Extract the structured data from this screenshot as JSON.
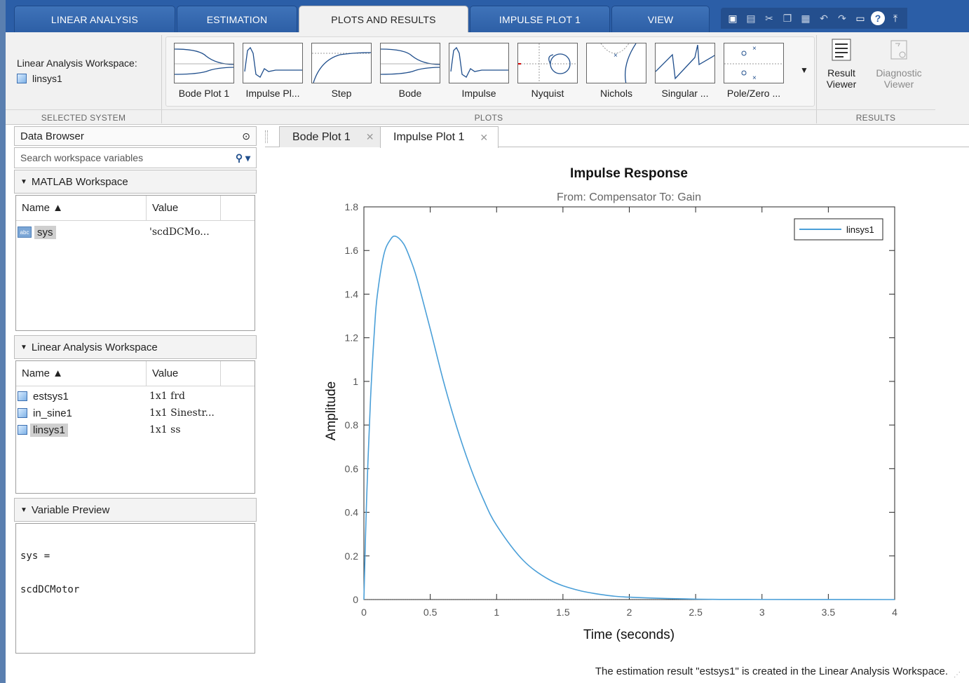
{
  "top_tabs": [
    {
      "label": "LINEAR ANALYSIS",
      "active": false
    },
    {
      "label": "ESTIMATION",
      "active": false
    },
    {
      "label": "PLOTS AND RESULTS",
      "active": true
    },
    {
      "label": "IMPULSE PLOT 1",
      "active": false
    },
    {
      "label": "VIEW",
      "active": false
    }
  ],
  "quick_access_icons": [
    "new-plot-icon",
    "save-icon",
    "cut-icon",
    "copy-icon",
    "paste-icon",
    "undo-icon",
    "redo-icon",
    "window-icon",
    "help-icon",
    "minimize-ribbon-icon"
  ],
  "ribbon": {
    "selected_system": {
      "title": "Linear Analysis Workspace:",
      "system": "linsys1",
      "footer": "SELECTED SYSTEM"
    },
    "plots": {
      "items": [
        "Bode Plot 1",
        "Impulse Pl...",
        "Step",
        "Bode",
        "Impulse",
        "Nyquist",
        "Nichols",
        "Singular ...",
        "Pole/Zero ..."
      ],
      "footer": "PLOTS",
      "more_glyph": "▼"
    },
    "results": {
      "result_viewer": [
        "Result",
        "Viewer"
      ],
      "diagnostic_viewer": [
        "Diagnostic",
        "Viewer"
      ],
      "footer": "RESULTS"
    }
  },
  "data_browser": {
    "title": "Data Browser",
    "search_placeholder": "Search workspace variables",
    "matlab_workspace": {
      "title": "MATLAB Workspace",
      "col_name": "Name ▲",
      "col_value": "Value",
      "rows": [
        {
          "name": "sys",
          "value": "'scdDCMo..."
        }
      ]
    },
    "linear_workspace": {
      "title": "Linear Analysis Workspace",
      "col_name": "Name ▲",
      "col_value": "Value",
      "rows": [
        {
          "name": "estsys1",
          "value": "1x1 frd"
        },
        {
          "name": "in_sine1",
          "value": "1x1 Sinestr..."
        },
        {
          "name": "linsys1",
          "value": "1x1 ss"
        }
      ]
    },
    "variable_preview": {
      "title": "Variable Preview",
      "lines": [
        "sys =",
        "scdDCMotor"
      ]
    }
  },
  "doc_tabs": [
    {
      "label": "Bode Plot 1",
      "active": false
    },
    {
      "label": "Impulse Plot 1",
      "active": true
    }
  ],
  "chart_data": {
    "type": "line",
    "title": "Impulse Response",
    "subtitle": "From: Compensator  To: Gain",
    "xlabel": "Time (seconds)",
    "ylabel": "Amplitude",
    "xlim": [
      0,
      4
    ],
    "ylim": [
      0,
      1.8
    ],
    "x_ticks": [
      "0",
      "0.5",
      "1",
      "1.5",
      "2",
      "2.5",
      "3",
      "3.5",
      "4"
    ],
    "y_ticks": [
      "0",
      "0.2",
      "0.4",
      "0.6",
      "0.8",
      "1",
      "1.2",
      "1.4",
      "1.6",
      "1.8"
    ],
    "legend_position": "top-right",
    "grid": false,
    "series": [
      {
        "name": "linsys1",
        "color": "#4a9fd8",
        "x": [
          0,
          0.02,
          0.05,
          0.08,
          0.1,
          0.15,
          0.2,
          0.24,
          0.3,
          0.35,
          0.4,
          0.5,
          0.6,
          0.7,
          0.8,
          0.9,
          1.0,
          1.2,
          1.4,
          1.6,
          1.8,
          2.0,
          2.5,
          3.0,
          3.5,
          4.0
        ],
        "y": [
          0,
          0.45,
          0.92,
          1.24,
          1.39,
          1.58,
          1.65,
          1.665,
          1.63,
          1.56,
          1.47,
          1.24,
          1.0,
          0.79,
          0.61,
          0.46,
          0.34,
          0.18,
          0.09,
          0.045,
          0.022,
          0.011,
          0.002,
          0.0004,
          0.0001,
          0.0
        ]
      }
    ]
  },
  "status_bar": "The estimation result \"estsys1\" is created in the Linear Analysis Workspace."
}
